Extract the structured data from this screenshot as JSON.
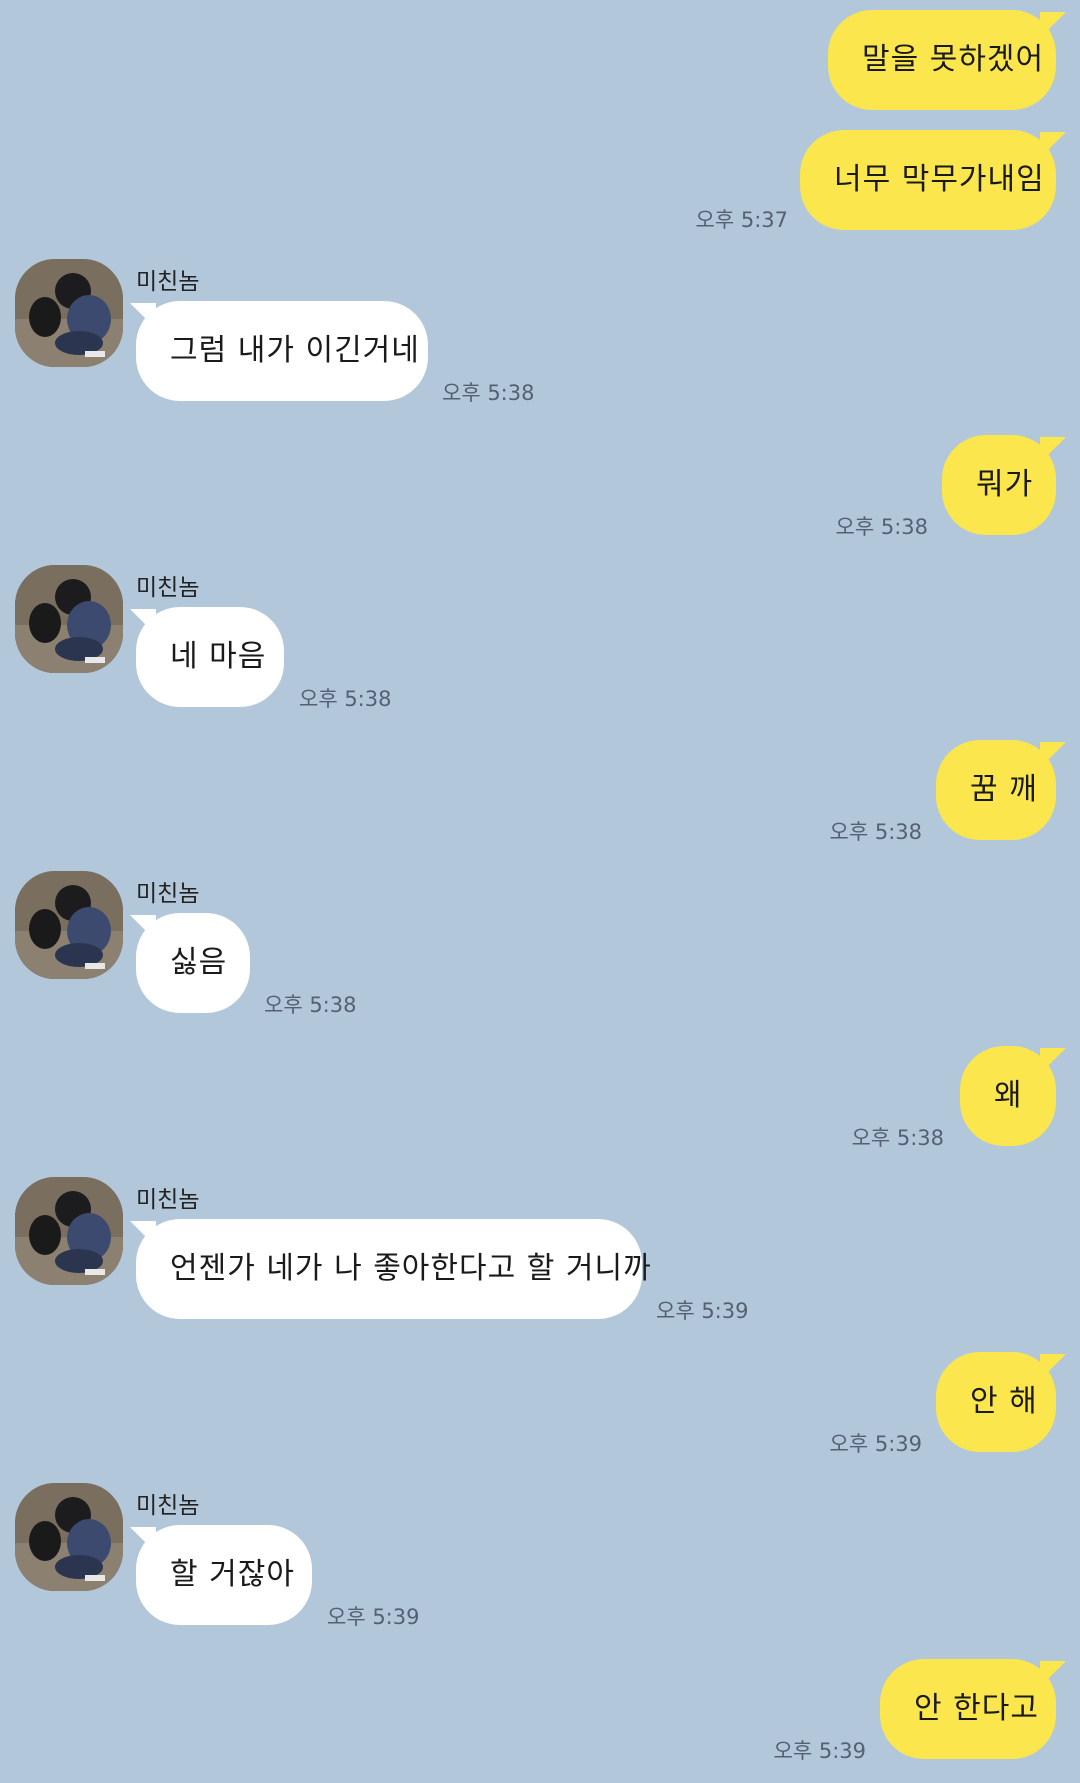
{
  "contact": {
    "name": "미친놈"
  },
  "messages": [
    {
      "from": "me",
      "text": "말을 못하겠어",
      "time": ""
    },
    {
      "from": "me",
      "text": "너무 막무가내임",
      "time": "오후 5:37"
    },
    {
      "from": "them",
      "text": "그럼 내가 이긴거네",
      "time": "오후 5:38"
    },
    {
      "from": "me",
      "text": "뭐가",
      "time": "오후 5:38"
    },
    {
      "from": "them",
      "text": "네 마음",
      "time": "오후 5:38"
    },
    {
      "from": "me",
      "text": "꿈 깨",
      "time": "오후 5:38"
    },
    {
      "from": "them",
      "text": "싫음",
      "time": "오후 5:38"
    },
    {
      "from": "me",
      "text": "왜",
      "time": "오후 5:38"
    },
    {
      "from": "them",
      "text": "언젠가 네가 나 좋아한다고 할 거니까",
      "time": "오후 5:39"
    },
    {
      "from": "me",
      "text": "안 해",
      "time": "오후 5:39"
    },
    {
      "from": "them",
      "text": "할 거잖아",
      "time": "오후 5:39"
    },
    {
      "from": "me",
      "text": "안 한다고",
      "time": "오후 5:39"
    }
  ],
  "colors": {
    "background": "#b2c7da",
    "sent_bubble": "#fbe74d",
    "received_bubble": "#ffffff",
    "time_text": "#556172"
  }
}
